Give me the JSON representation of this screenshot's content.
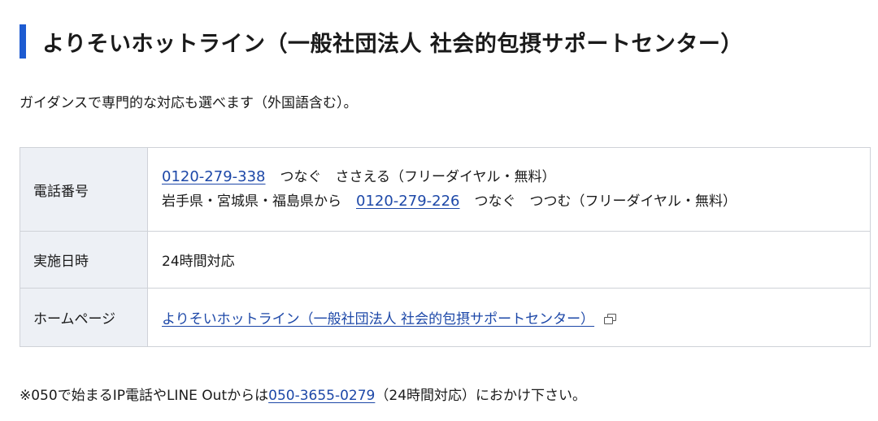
{
  "heading": {
    "title": "よりそいホットライン（一般社団法人 社会的包摂サポートセンター）",
    "accent_color": "#1d5bd1"
  },
  "intro": {
    "text": "ガイダンスで専門的な対応も選べます（外国語含む）。"
  },
  "table": {
    "phone": {
      "label": "電話番号",
      "line1_number": "0120-279-338",
      "line1_desc": "つなぐ　ささえる（フリーダイヤル・無料）",
      "line2_prefix": "岩手県・宮城県・福島県から",
      "line2_number": "0120-279-226",
      "line2_desc": "つなぐ　つつむ（フリーダイヤル・無料）"
    },
    "hours": {
      "label": "実施日時",
      "value": "24時間対応"
    },
    "homepage": {
      "label": "ホームページ",
      "link_text": "よりそいホットライン（一般社団法人 社会的包摂サポートセンター）",
      "icon": "external-link-icon"
    }
  },
  "note": {
    "prefix": "※050で始まるIP電話やLINE Outからは",
    "number": "050-3655-0279",
    "suffix": "（24時間対応）におかけ下さい。"
  },
  "colors": {
    "link": "#1d48a8",
    "header_cell_bg": "#edf0f5",
    "border": "#cfd2d8"
  }
}
